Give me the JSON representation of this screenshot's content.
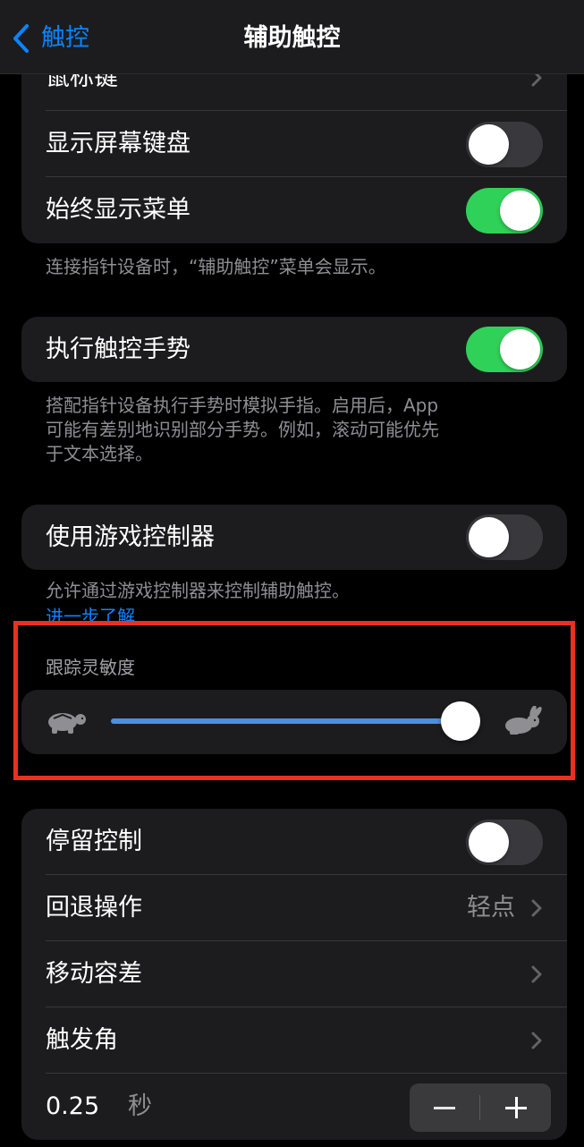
{
  "nav": {
    "back_label": "触控",
    "title": "辅助触控"
  },
  "group1": {
    "mouse_keys": "鼠标键",
    "show_onscreen_keyboard": "显示屏幕键盘",
    "show_onscreen_keyboard_on": false,
    "always_show_menu": "始终显示菜单",
    "always_show_menu_on": true,
    "footer": "连接指针设备时，“辅助触控”菜单会显示。"
  },
  "group2": {
    "perform_touch_gestures": "执行触控手势",
    "perform_touch_gestures_on": true,
    "footer_lines": [
      "搭配指针设备执行手势时模拟手指。启用后，App",
      "可能有差别地识别部分手势。例如，滚动可能优先",
      "于文本选择。"
    ]
  },
  "group3": {
    "use_game_controller": "使用游戏控制器",
    "use_game_controller_on": false,
    "footer": "允许通过游戏控制器来控制辅助触控。",
    "learn_more": "进一步了解"
  },
  "tracking": {
    "header": "跟踪灵敏度",
    "slider_value": 1.0,
    "slow_icon": "turtle-icon",
    "fast_icon": "rabbit-icon"
  },
  "group4": {
    "dwell_control": "停留控制",
    "dwell_control_on": false,
    "fallback_action": "回退操作",
    "fallback_value": "轻点",
    "movement_tolerance": "移动容差",
    "hot_corners": "触发角",
    "duration_value": "0.25",
    "duration_unit": "秒"
  },
  "colors": {
    "accent": "#0a84ff",
    "switch_on": "#30d158",
    "highlight": "#e8321e"
  }
}
